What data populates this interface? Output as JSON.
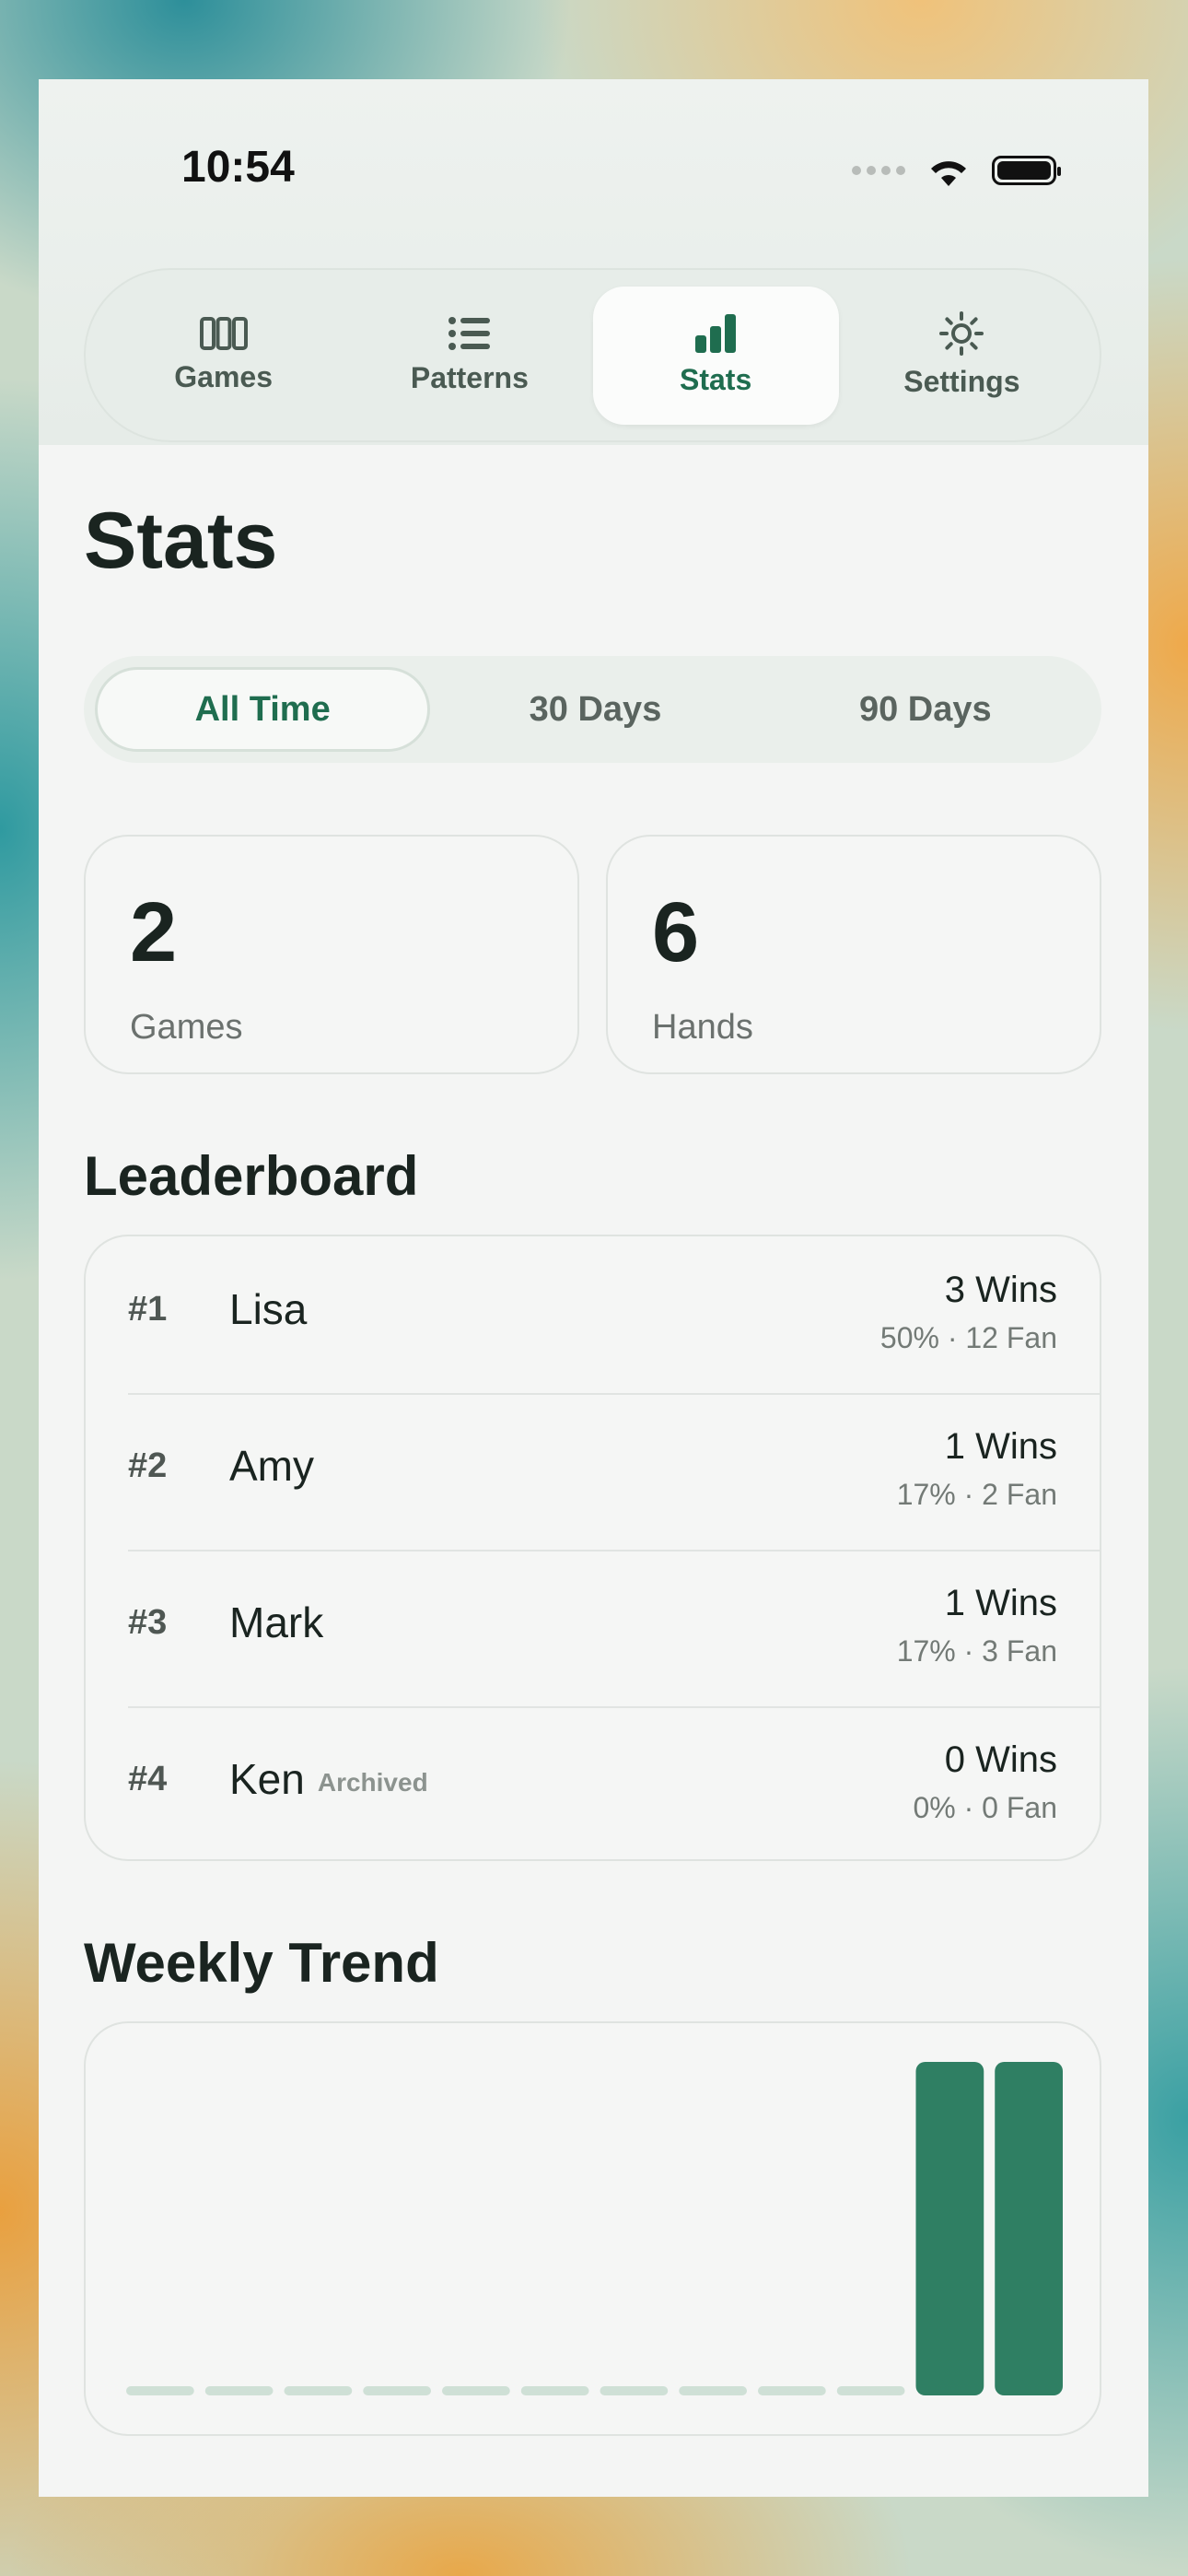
{
  "status_bar": {
    "time": "10:54"
  },
  "tabs": [
    {
      "label": "Games",
      "icon": "columns-icon",
      "active": false
    },
    {
      "label": "Patterns",
      "icon": "list-icon",
      "active": false
    },
    {
      "label": "Stats",
      "icon": "bar-chart-icon",
      "active": true
    },
    {
      "label": "Settings",
      "icon": "gear-icon",
      "active": false
    }
  ],
  "page_title": "Stats",
  "range_filter": {
    "options": [
      "All Time",
      "30 Days",
      "90 Days"
    ],
    "selected": "All Time"
  },
  "summary": [
    {
      "value": "2",
      "label": "Games"
    },
    {
      "value": "6",
      "label": "Hands"
    }
  ],
  "leaderboard": {
    "title": "Leaderboard",
    "rows": [
      {
        "rank": "#1",
        "name": "Lisa",
        "badge": "",
        "wins": "3 Wins",
        "detail": "50% · 12 Fan"
      },
      {
        "rank": "#2",
        "name": "Amy",
        "badge": "",
        "wins": "1 Wins",
        "detail": "17% · 2 Fan"
      },
      {
        "rank": "#3",
        "name": "Mark",
        "badge": "",
        "wins": "1 Wins",
        "detail": "17% · 3 Fan"
      },
      {
        "rank": "#4",
        "name": "Ken",
        "badge": "Archived",
        "wins": "0 Wins",
        "detail": "0% · 0 Fan"
      }
    ]
  },
  "weekly_trend": {
    "title": "Weekly Trend",
    "colors": {
      "bar": "#2f7f63",
      "empty": "#cfe0d6"
    }
  },
  "chart_data": {
    "type": "bar",
    "values": [
      0,
      0,
      0,
      0,
      0,
      0,
      0,
      0,
      0,
      0,
      1,
      1
    ],
    "ylim": [
      0,
      1
    ],
    "grid": false
  }
}
